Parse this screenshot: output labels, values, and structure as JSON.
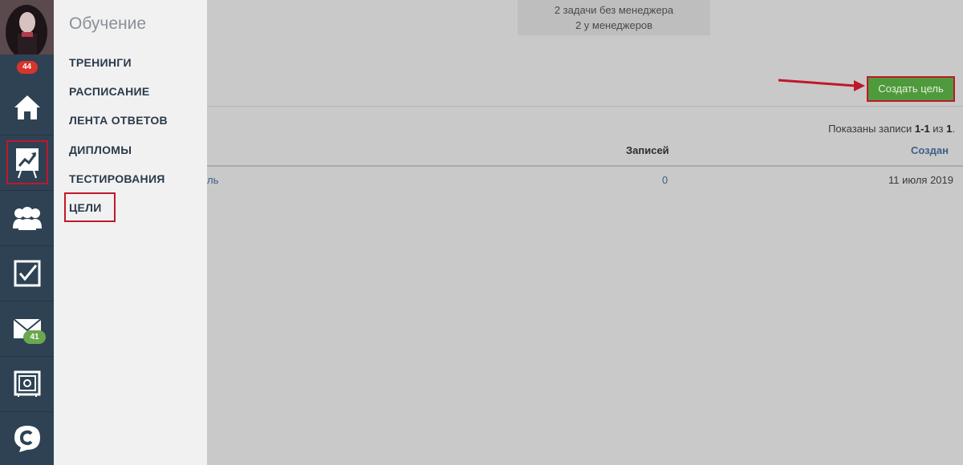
{
  "header": {
    "tasks_without_manager": "2 задачи без менеджера",
    "tasks_with_managers": "2 у менеджеров"
  },
  "toolbar": {
    "create_goal_label": "Создать цель"
  },
  "table": {
    "shown_prefix": "Показаны записи ",
    "shown_range": "1-1",
    "shown_of": " из ",
    "shown_total": "1",
    "shown_suffix": ".",
    "columns": [
      "Записей",
      "Создан"
    ],
    "rows": [
      {
        "name_fragment": "ль",
        "records": "0",
        "created": "11 июля 2019"
      }
    ]
  },
  "sidebar": {
    "avatar_badge": "44",
    "mail_badge": "41",
    "items": [
      {
        "icon": "home-icon"
      },
      {
        "icon": "chart-board-icon"
      },
      {
        "icon": "users-icon"
      },
      {
        "icon": "checkbox-icon"
      },
      {
        "icon": "mail-icon"
      },
      {
        "icon": "safe-icon"
      },
      {
        "icon": "chat-logo-icon"
      }
    ]
  },
  "menu": {
    "title": "Обучение",
    "items": [
      "ТРЕНИНГИ",
      "РАСПИСАНИЕ",
      "ЛЕНТА ОТВЕТОВ",
      "ДИПЛОМЫ",
      "ТЕСТИРОВАНИЯ",
      "ЦЕЛИ"
    ]
  },
  "colors": {
    "sidebar_bg": "#2e4254",
    "menu_bg": "#f1f1f1",
    "accent_green": "#4f9a3c",
    "highlight_red": "#c0182a",
    "badge_red": "#d9342b",
    "badge_green": "#6aa84f",
    "link": "#3d5e8a"
  }
}
